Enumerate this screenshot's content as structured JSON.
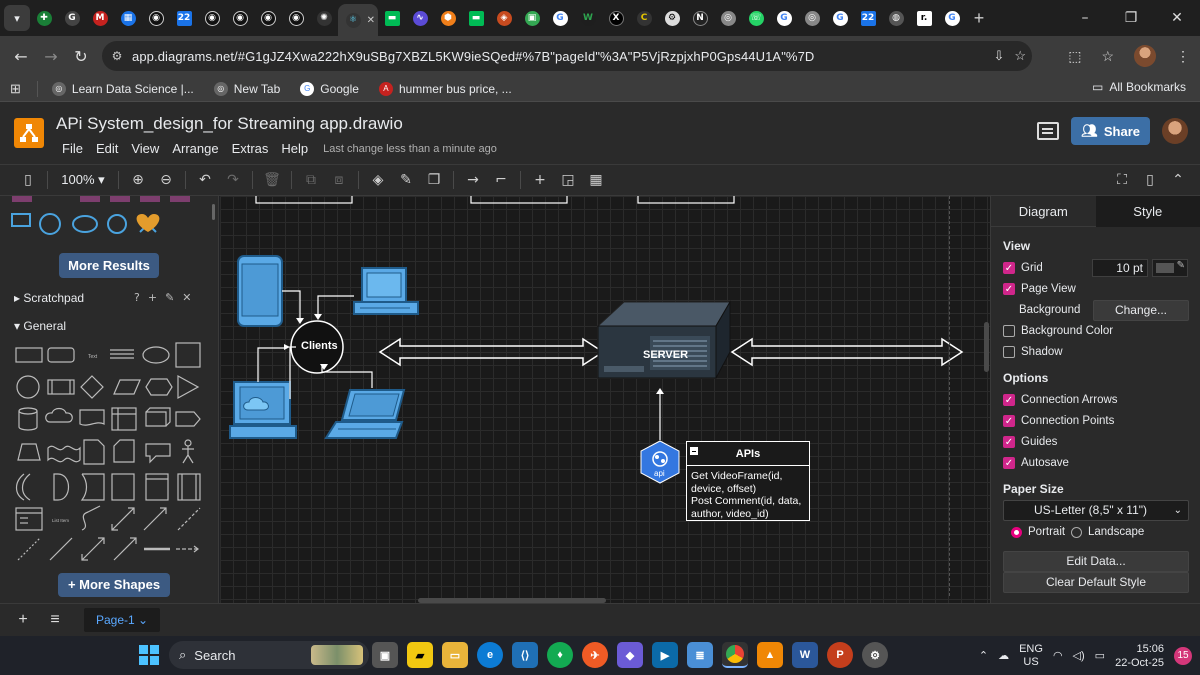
{
  "browser": {
    "url": "app.diagrams.net/#G1gJZ4Xwa222hX9uSBg7XBZL5KW9ieSQed#%7B\"pageId\"%3A\"P5VjRzpjxhP0Gps44U1A\"%7D",
    "bookmarks": [
      {
        "label": "Learn Data Science |...",
        "icon": "globe-icon"
      },
      {
        "label": "New Tab",
        "icon": "globe-icon"
      },
      {
        "label": "Google",
        "icon": "google-icon"
      },
      {
        "label": "hummer bus price, ...",
        "icon": "ad-icon"
      }
    ],
    "all_bookmarks": "All Bookmarks"
  },
  "app": {
    "title": "APi System_design_for Streaming app.drawio",
    "menu": [
      "File",
      "Edit",
      "View",
      "Arrange",
      "Extras",
      "Help"
    ],
    "last_change": "Last change less than a minute ago",
    "share_label": "Share",
    "zoom": "100%"
  },
  "sidebar": {
    "more_results": "More Results",
    "scratchpad": "Scratchpad",
    "general": "General",
    "more_shapes": "+ More Shapes"
  },
  "canvas": {
    "clients_label": "Clients",
    "server_label": "SERVER",
    "api_icon_label": "api",
    "apis_title": "APIs",
    "apis_lines": [
      "Get VideoFrame(id,",
      "device, offset)",
      "Post Comment(id, data,",
      "author, video_id)"
    ]
  },
  "format_panel": {
    "tab_diagram": "Diagram",
    "tab_style": "Style",
    "view_header": "View",
    "grid_label": "Grid",
    "grid_size": "10 pt",
    "page_view": "Page View",
    "background_label": "Background",
    "change_button": "Change...",
    "background_color": "Background Color",
    "shadow": "Shadow",
    "options_header": "Options",
    "connection_arrows": "Connection Arrows",
    "connection_points": "Connection Points",
    "guides": "Guides",
    "autosave": "Autosave",
    "paper_size_header": "Paper Size",
    "paper_size": "US-Letter (8,5\" x 11\")",
    "portrait": "Portrait",
    "landscape": "Landscape",
    "edit_data": "Edit Data...",
    "clear_default_style": "Clear Default Style",
    "accent_color": "#d0268b"
  },
  "pagebar": {
    "page_tab": "Page-1"
  },
  "taskbar": {
    "search": "Search",
    "lang_top": "ENG",
    "lang_bottom": "US",
    "time": "15:06",
    "date": "22-Oct-25",
    "notifications": "15"
  }
}
